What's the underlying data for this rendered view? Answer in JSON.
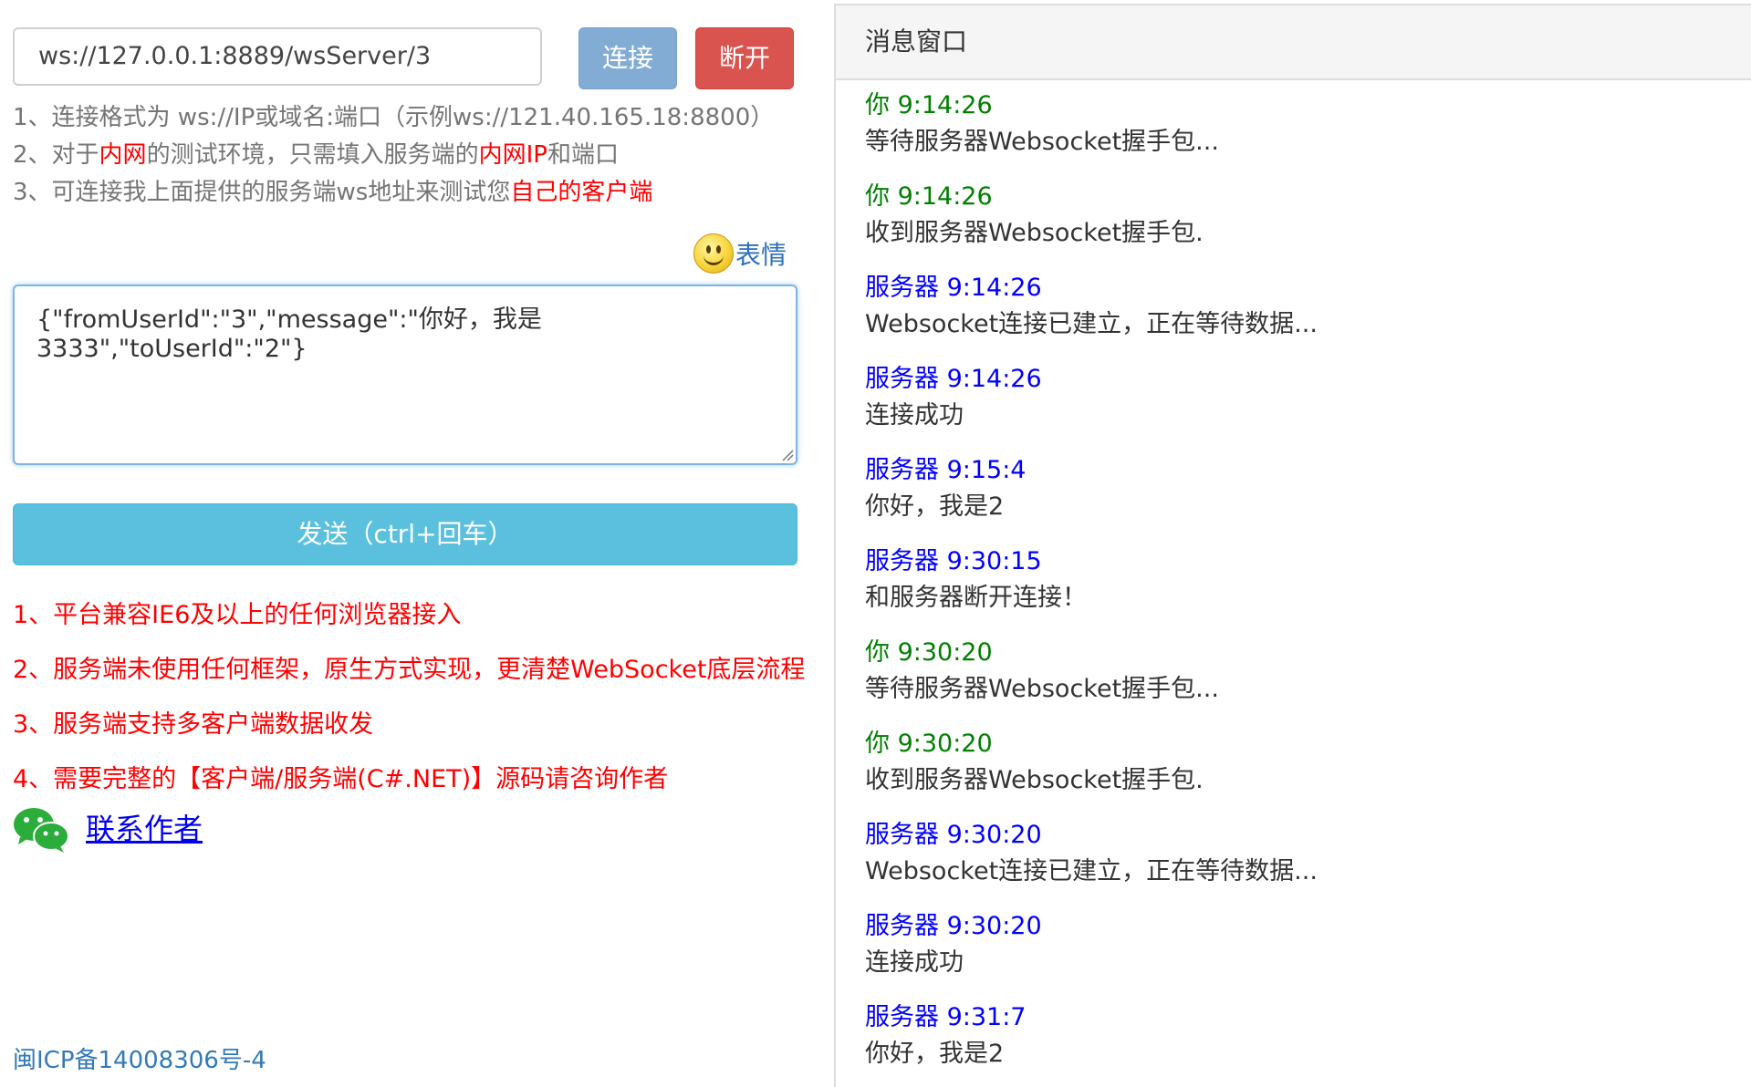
{
  "connection": {
    "url": "ws://127.0.0.1:8889/wsServer/3",
    "connect_label": "连接",
    "disconnect_label": "断开"
  },
  "hints": [
    {
      "parts": [
        {
          "text": "1、连接格式为 ws://IP或域名:端口（示例ws://121.40.165.18:8800）",
          "red": false
        }
      ]
    },
    {
      "parts": [
        {
          "text": "2、对于",
          "red": false
        },
        {
          "text": "内网",
          "red": true
        },
        {
          "text": "的测试环境，只需填入服务端的",
          "red": false
        },
        {
          "text": "内网IP",
          "red": true
        },
        {
          "text": "和端口",
          "red": false
        }
      ]
    },
    {
      "parts": [
        {
          "text": "3、可连接我上面提供的服务端ws地址来测试您",
          "red": false
        },
        {
          "text": "自己的客户端",
          "red": true
        }
      ]
    }
  ],
  "emoji_label": "表情",
  "message_input": "{\"fromUserId\":\"3\",\"message\":\"你好，我是3333\",\"toUserId\":\"2\"}",
  "send_label": "发送（ctrl+回车）",
  "features": [
    "1、平台兼容IE6及以上的任何浏览器接入",
    "2、服务端未使用任何框架，原生方式实现，更清楚WebSocket底层流程",
    "3、服务端支持多客户端数据收发",
    "4、需要完整的【客户端/服务端(C#.NET)】源码请咨询作者"
  ],
  "contact_label": "联系作者",
  "icp": "闽ICP备14008306号-4",
  "panel_title": "消息窗口",
  "messages": [
    {
      "sender": "你",
      "time": "9:14:26",
      "kind": "you",
      "text": "等待服务器Websocket握手包..."
    },
    {
      "sender": "你",
      "time": "9:14:26",
      "kind": "you",
      "text": "收到服务器Websocket握手包."
    },
    {
      "sender": "服务器",
      "time": "9:14:26",
      "kind": "server",
      "text": "Websocket连接已建立，正在等待数据..."
    },
    {
      "sender": "服务器",
      "time": "9:14:26",
      "kind": "server",
      "text": "连接成功"
    },
    {
      "sender": "服务器",
      "time": "9:15:4",
      "kind": "server",
      "text": "你好，我是2"
    },
    {
      "sender": "服务器",
      "time": "9:30:15",
      "kind": "server",
      "text": "和服务器断开连接！"
    },
    {
      "sender": "你",
      "time": "9:30:20",
      "kind": "you",
      "text": "等待服务器Websocket握手包..."
    },
    {
      "sender": "你",
      "time": "9:30:20",
      "kind": "you",
      "text": "收到服务器Websocket握手包."
    },
    {
      "sender": "服务器",
      "time": "9:30:20",
      "kind": "server",
      "text": "Websocket连接已建立，正在等待数据..."
    },
    {
      "sender": "服务器",
      "time": "9:30:20",
      "kind": "server",
      "text": "连接成功"
    },
    {
      "sender": "服务器",
      "time": "9:31:7",
      "kind": "server",
      "text": "你好，我是2"
    }
  ]
}
